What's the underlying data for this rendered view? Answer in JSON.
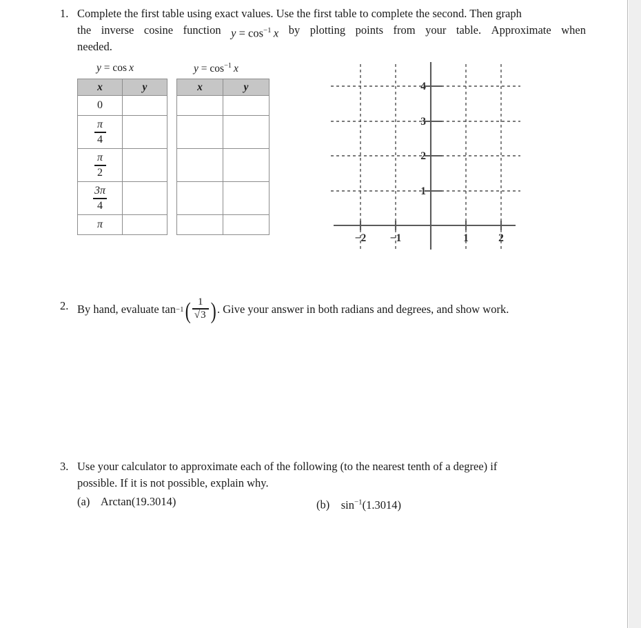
{
  "page": {
    "background": "#ffffff",
    "gutter_color": "#efefef",
    "border_color": "#b9b9b9"
  },
  "problems": [
    {
      "number": "1.",
      "text_lines": [
        "Complete the first table using exact values. Use the first table to complete the second. Then graph",
        "the inverse cosine function  y = cos⁻¹ x  by plotting points from your table. Approximate when",
        "needed."
      ],
      "text_plain": "Complete the first table using exact values. Use the first table to complete the second. Then graph the inverse cosine function y = cos⁻¹ x by plotting points from your table. Approximate when needed."
    },
    {
      "number": "2.",
      "text_before": "By hand, evaluate",
      "expression": "tan⁻¹(1/√3)",
      "text_after": ". Give your answer in both radians and degrees, and show work.",
      "math": {
        "function": "tan",
        "exponent": "-1",
        "numerator": "1",
        "denominator": "√3",
        "denominator_radicand": "3"
      }
    },
    {
      "number": "3.",
      "text_lines": [
        "Use your calculator to approximate each of the following (to the nearest tenth of a degree) if",
        "possible. If it is not possible, explain why."
      ],
      "subitems": [
        {
          "label": "(a)",
          "expression": "Arctan(19.3014)",
          "func": "Arctan",
          "arg": "19.3014",
          "has_sup": false
        },
        {
          "label": "(b)",
          "expression": "sin⁻¹(1.3014)",
          "func": "sin",
          "sup": "-1",
          "arg": "(1.3014)",
          "has_sup": true
        }
      ]
    }
  ],
  "tables": [
    {
      "caption_plain": "y = cos x",
      "caption": {
        "lhs": "y",
        "eq": "=",
        "func": "cos",
        "sup": "",
        "arg": "x"
      },
      "headers": [
        "x",
        "y"
      ],
      "header_fill": "#c6c6c6",
      "border_color": "#8c8c8c",
      "rows": [
        {
          "x_display": "0",
          "x_type": "plain",
          "y_display": ""
        },
        {
          "x_display": "π/4",
          "x_type": "fraction",
          "num": "π",
          "den": "4",
          "y_display": ""
        },
        {
          "x_display": "π/2",
          "x_type": "fraction",
          "num": "π",
          "den": "2",
          "y_display": ""
        },
        {
          "x_display": "3π/4",
          "x_type": "fraction",
          "num": "3π",
          "den": "4",
          "y_display": ""
        },
        {
          "x_display": "π",
          "x_type": "plain",
          "y_display": ""
        }
      ]
    },
    {
      "caption_plain": "y = cos⁻¹ x",
      "caption": {
        "lhs": "y",
        "eq": "=",
        "func": "cos",
        "sup": "-1",
        "arg": "x"
      },
      "headers": [
        "x",
        "y"
      ],
      "header_fill": "#c6c6c6",
      "border_color": "#8c8c8c",
      "rows": [
        {
          "x_display": "",
          "y_display": ""
        },
        {
          "x_display": "",
          "y_display": ""
        },
        {
          "x_display": "",
          "y_display": ""
        },
        {
          "x_display": "",
          "y_display": ""
        },
        {
          "x_display": "",
          "y_display": ""
        }
      ]
    }
  ],
  "chart_data": {
    "type": "scatter",
    "title": "",
    "xlabel": "",
    "ylabel": "",
    "x_ticks": [
      -2,
      -1,
      1,
      2
    ],
    "x_tick_labels": [
      "−2",
      "−1",
      "1",
      "2"
    ],
    "y_ticks": [
      1,
      2,
      3,
      4
    ],
    "y_tick_labels": [
      "1",
      "2",
      "3",
      "4"
    ],
    "xlim": [
      -2.6,
      2.6
    ],
    "ylim": [
      -0.75,
      4.6
    ],
    "grid": true,
    "grid_style": "dashed",
    "grid_color": "#4d4d4d",
    "axis_color": "#595959",
    "legend": "none",
    "series": [],
    "values": [],
    "note": "empty coordinate grid for plotting y = cos^-1 x"
  }
}
